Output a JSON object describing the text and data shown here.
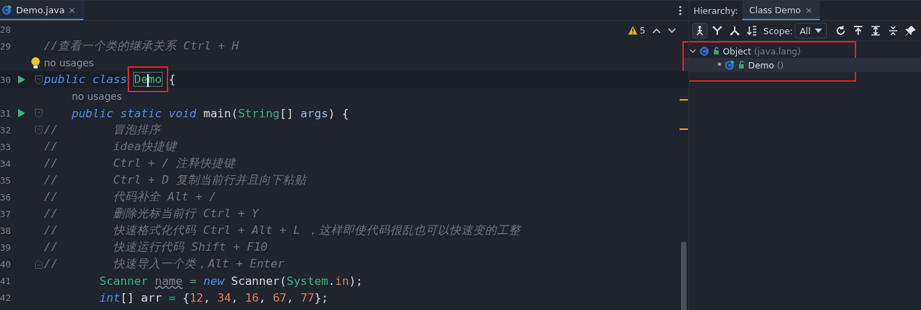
{
  "editor_tabs": [
    {
      "label": "Demo.java",
      "close": "×",
      "selected": true
    }
  ],
  "inspections": {
    "warnings": "5"
  },
  "code": [
    {
      "kind": "code",
      "number": "28",
      "run": false,
      "current": false
    },
    {
      "kind": "code",
      "number": "29",
      "run": false,
      "current": false,
      "tokens": [
        {
          "kind": "comment",
          "s": "//查看一个类的继承关系 Ctrl + H"
        }
      ]
    },
    {
      "kind": "hint",
      "text": "no usages",
      "bulb": true
    },
    {
      "kind": "code",
      "number": "30",
      "run": true,
      "current": true,
      "fold": {
        "kind": "open"
      },
      "tokens": [
        {
          "kind": "keyword",
          "s": "public class "
        },
        {
          "kind": "boxed",
          "s": "Demo"
        },
        {
          "kind": "plain",
          "s": " {"
        }
      ]
    },
    {
      "kind": "hint",
      "text": "no usages",
      "bulb": false
    },
    {
      "kind": "code",
      "number": "31",
      "run": true,
      "current": false,
      "fold": {
        "kind": "open"
      },
      "tokens": [
        {
          "kind": "keyword",
          "s": "    public static void"
        },
        {
          "kind": "plain",
          "s": " main("
        },
        {
          "kind": "type",
          "s": "String"
        },
        {
          "kind": "plain",
          "s": "[] "
        },
        {
          "kind": "param",
          "s": "args"
        },
        {
          "kind": "plain",
          "s": ") {"
        }
      ]
    },
    {
      "kind": "code",
      "number": "32",
      "run": false,
      "current": false,
      "fold": {
        "kind": "open"
      },
      "tokens": [
        {
          "kind": "comment",
          "s": "//        冒泡排序"
        }
      ]
    },
    {
      "kind": "code",
      "number": "33",
      "run": false,
      "current": false,
      "tokens": [
        {
          "kind": "comment",
          "s": "//        idea快捷键"
        }
      ]
    },
    {
      "kind": "code",
      "number": "34",
      "run": false,
      "current": false,
      "tokens": [
        {
          "kind": "comment",
          "s": "//        Ctrl + / 注释快捷键"
        }
      ]
    },
    {
      "kind": "code",
      "number": "35",
      "run": false,
      "current": false,
      "tokens": [
        {
          "kind": "comment",
          "s": "//        Ctrl + D 复制当前行并且向下粘贴"
        }
      ]
    },
    {
      "kind": "code",
      "number": "36",
      "run": false,
      "current": false,
      "tokens": [
        {
          "kind": "comment",
          "s": "//        代码补全 Alt + /"
        }
      ]
    },
    {
      "kind": "code",
      "number": "37",
      "run": false,
      "current": false,
      "tokens": [
        {
          "kind": "comment",
          "s": "//        删除光标当前行 Ctrl + Y"
        }
      ]
    },
    {
      "kind": "code",
      "number": "38",
      "run": false,
      "current": false,
      "tokens": [
        {
          "kind": "comment",
          "s": "//        快速格式化代码 Ctrl + Alt + L ，这样即使代码很乱也可以快速变的工整"
        }
      ]
    },
    {
      "kind": "code",
      "number": "39",
      "run": false,
      "current": false,
      "tokens": [
        {
          "kind": "comment",
          "s": "//        快速运行代码 Shift + F10"
        }
      ]
    },
    {
      "kind": "code",
      "number": "40",
      "run": false,
      "current": false,
      "fold": {
        "kind": "end"
      },
      "tokens": [
        {
          "kind": "comment",
          "s": "//        快速导入一个类，Alt + Enter"
        }
      ]
    },
    {
      "kind": "code",
      "number": "41",
      "run": false,
      "current": false,
      "tokens": [
        {
          "kind": "type",
          "s": "        Scanner "
        },
        {
          "kind": "unused",
          "s": "name"
        },
        {
          "kind": "op",
          "s": " = "
        },
        {
          "kind": "keyword",
          "s": "new"
        },
        {
          "kind": "plain",
          "s": " Scanner("
        },
        {
          "kind": "type",
          "s": "System"
        },
        {
          "kind": "plain",
          "s": "."
        },
        {
          "kind": "field",
          "s": "in"
        },
        {
          "kind": "plain",
          "s": ");"
        }
      ]
    },
    {
      "kind": "code",
      "number": "42",
      "run": false,
      "current": false,
      "tokens": [
        {
          "kind": "keyword",
          "s": "        int"
        },
        {
          "kind": "plain",
          "s": "[] arr "
        },
        {
          "kind": "op",
          "s": "="
        },
        {
          "kind": "plain",
          "s": " {"
        },
        {
          "kind": "number",
          "s": "12"
        },
        {
          "kind": "plain",
          "s": ", "
        },
        {
          "kind": "number",
          "s": "34"
        },
        {
          "kind": "plain",
          "s": ", "
        },
        {
          "kind": "number",
          "s": "16"
        },
        {
          "kind": "plain",
          "s": ", "
        },
        {
          "kind": "number",
          "s": "67"
        },
        {
          "kind": "plain",
          "s": ", "
        },
        {
          "kind": "number",
          "s": "77"
        },
        {
          "kind": "plain",
          "s": "};"
        }
      ]
    }
  ],
  "hierarchy": {
    "label": "Hierarchy:",
    "tabs": [
      {
        "label": "Class Demo",
        "close": "×",
        "selected": true
      }
    ],
    "toolbar_left": [
      {
        "kind": "hierarchy",
        "selected": true
      },
      {
        "kind": "supertypes",
        "selected": false
      },
      {
        "kind": "subtypes",
        "selected": false
      },
      {
        "kind": "sort",
        "selected": false
      }
    ],
    "scope_label": "Scope:",
    "scope": "All",
    "toolbar_right": [
      {
        "kind": "refresh",
        "selected": false
      },
      {
        "kind": "export",
        "selected": false
      },
      {
        "kind": "expand",
        "selected": false
      },
      {
        "kind": "collapse",
        "selected": false
      },
      {
        "kind": "pin",
        "selected": false
      }
    ],
    "tree": [
      {
        "name": "Object",
        "package": "(java.lang)",
        "expanded": true,
        "selected": false,
        "runnable": false,
        "children": [
          {
            "marker": "*",
            "name": "Demo",
            "package": "()",
            "selected": true,
            "runnable": true
          }
        ]
      }
    ]
  }
}
